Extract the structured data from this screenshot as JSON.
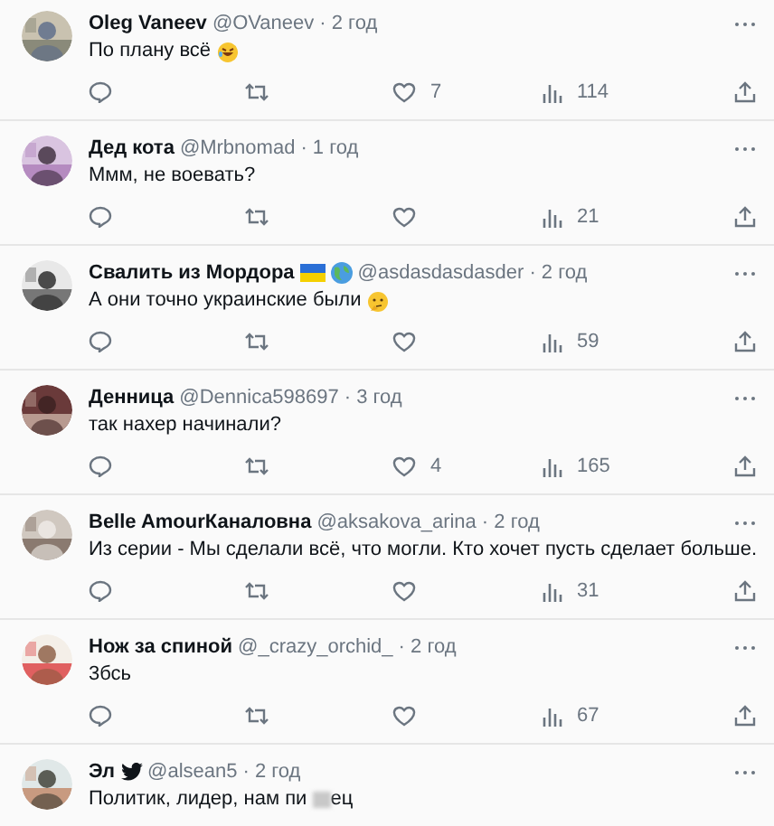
{
  "replies": [
    {
      "name": "Oleg Vaneev",
      "handle": "@OVaneev",
      "time": "· 2 год",
      "text": "По плану всё",
      "emoji": {
        "kind": "laughing"
      },
      "like_count": "7",
      "views": "114"
    },
    {
      "name": "Дед кота",
      "handle": "@Mrbnomad",
      "time": "· 1 год",
      "text": "Ммм, не воевать?",
      "views": "21"
    },
    {
      "name": "Свалить из Мордора",
      "badges": [
        {
          "kind": "flag"
        },
        {
          "kind": "globe"
        }
      ],
      "handle": "@asdasdasdasder",
      "time": "· 2 год",
      "text": "А они точно украинские были",
      "emoji": {
        "kind": "thinking"
      },
      "views": "59"
    },
    {
      "name": "Денница",
      "handle": "@Dennica598697",
      "time": "· 3 год",
      "text": "так нахер начинали?",
      "like_count": "4",
      "views": "165"
    },
    {
      "name": "Belle AmourКаналовна",
      "handle": "@aksakova_arina",
      "time": "· 2 год",
      "text": "Из серии - Мы сделали всё, что могли. Кто хочет пусть сделает больше.",
      "views": "31"
    },
    {
      "name": "Нож за спиной",
      "handle": "@_crazy_orchid_",
      "time": "· 2 год",
      "text": "3бсь",
      "views": "67"
    },
    {
      "name": "Эл",
      "badges": [
        {
          "kind": "bird"
        }
      ],
      "handle": "@alsean5",
      "time": "· 2 год",
      "text": "Политик, лидер, нам пи",
      "censored": true,
      "text_after": "ец"
    }
  ]
}
